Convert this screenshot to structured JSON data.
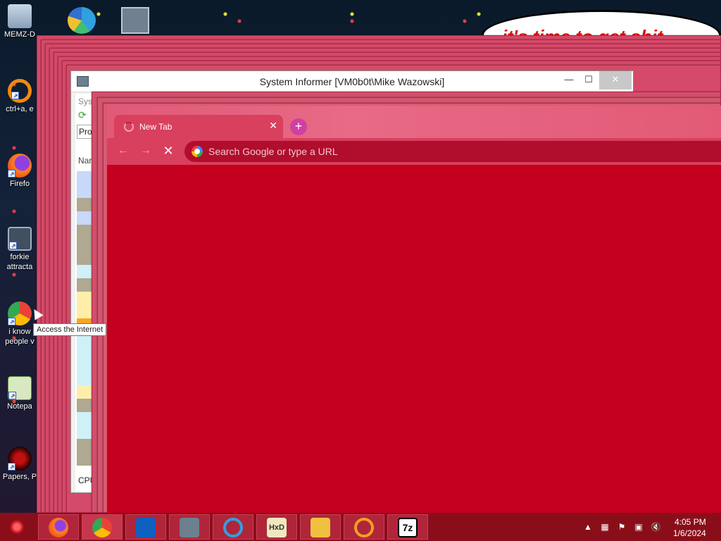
{
  "desktop": {
    "icons": [
      {
        "label": "MEMZ-D"
      },
      {
        "label": "ctrl+a, e"
      },
      {
        "label": "Firefo"
      },
      {
        "label": "forkie attracta"
      },
      {
        "label": "i know people v"
      },
      {
        "label": "Notepa"
      },
      {
        "label": "Papers, P"
      }
    ],
    "bubble_text": "it's time to get shit"
  },
  "system_informer": {
    "title": "System Informer [VM0b0t\\Mike Wazowski]",
    "menu_stub": "Sys",
    "tab_stub": "Pro",
    "column_stub": "Nar",
    "status_stub": "CPU"
  },
  "browser": {
    "tab_title": "New Tab",
    "omnibox_placeholder": "Search Google or type a URL"
  },
  "tooltip": {
    "text": "Access the Internet"
  },
  "taskbar": {
    "apps": [
      "firefox",
      "chrome",
      "outlook",
      "system-informer",
      "internet-explorer",
      "hxd",
      "file-explorer",
      "search-tool",
      "7zip"
    ],
    "sevenzip_label": "7z",
    "hxd_label": "HxD",
    "clock_time": "4:05 PM",
    "clock_date": "1/6/2024"
  },
  "colors": {
    "browser_bg": "#c4001e",
    "taskbar": "#8a0e1a",
    "tab_active": "#d8405e"
  }
}
